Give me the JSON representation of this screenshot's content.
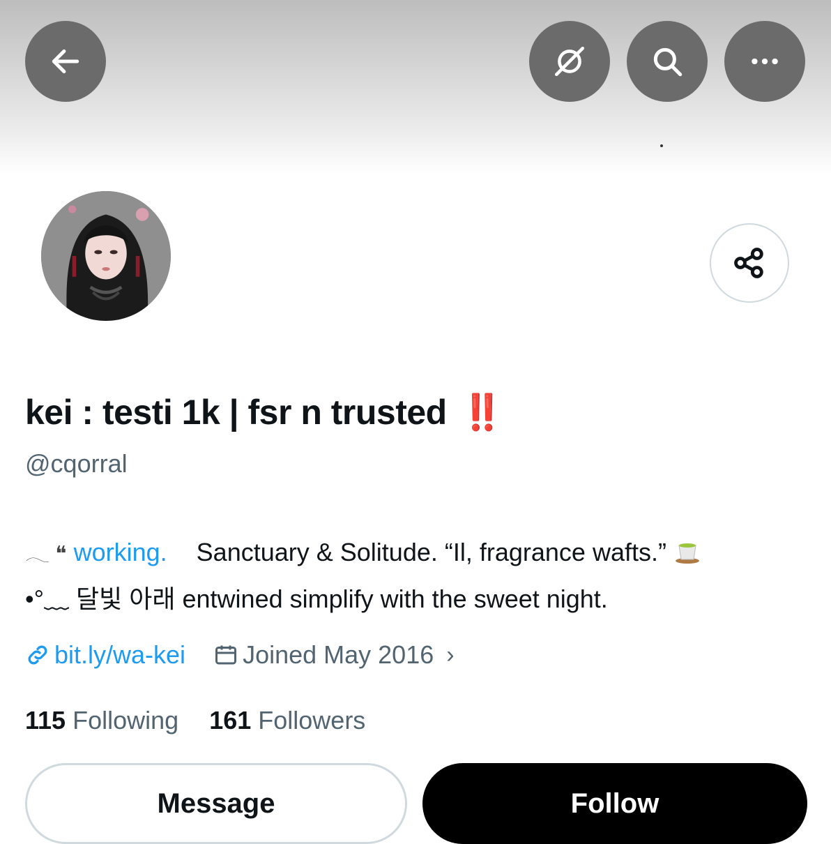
{
  "header": {
    "back_icon": "arrow-left-icon",
    "grok_icon": "grok-icon",
    "search_icon": "search-icon",
    "more_icon": "more-horizontal-icon"
  },
  "profile": {
    "display_name": "kei : testi 1k | fsr n trusted",
    "name_emoji": "‼️",
    "handle": "@cqorral",
    "bio": {
      "line1_glyphs": "𓂃 ❝",
      "line1_link": "working.",
      "line1_text": "Sanctuary & Solitude. “Il, fragrance wafts.”",
      "line1_emoji": "teacup-icon",
      "line2_prefix": "•°﹏",
      "line2_text": "달빛 아래 entwined simplify with the sweet night."
    },
    "website": "bit.ly/wa-kei",
    "joined": "Joined May 2016",
    "following_count": "115",
    "following_label": "Following",
    "followers_count": "161",
    "followers_label": "Followers"
  },
  "actions": {
    "message_label": "Message",
    "follow_label": "Follow"
  },
  "colors": {
    "link": "#1d9bf0",
    "muted": "#536471",
    "text": "#0f1419",
    "follow_bg": "#000000",
    "header_button_bg": "#6b6b6b"
  }
}
